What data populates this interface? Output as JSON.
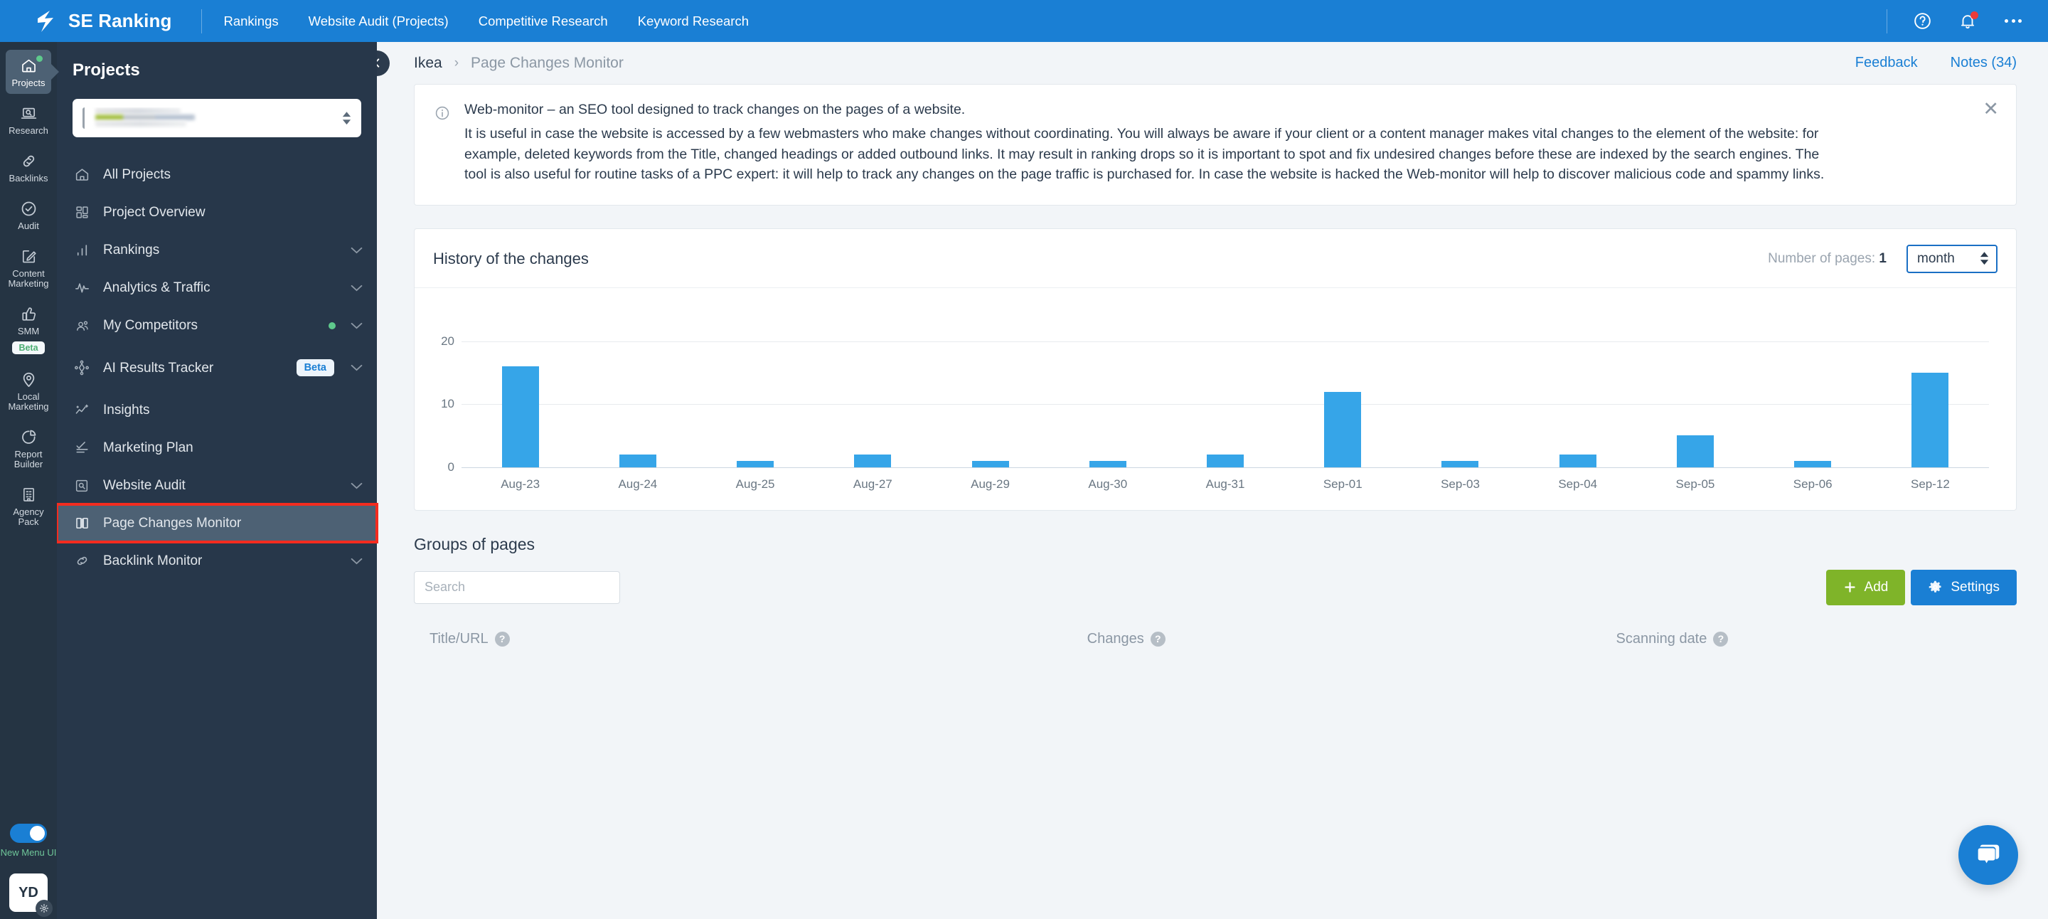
{
  "topbar": {
    "brand": "SE Ranking",
    "nav": [
      {
        "label": "Rankings"
      },
      {
        "label": "Website Audit (Projects)"
      },
      {
        "label": "Competitive Research"
      },
      {
        "label": "Keyword Research"
      }
    ]
  },
  "rail": {
    "items": [
      {
        "label": "Projects",
        "icon": "home-icon",
        "active": true,
        "dot": true
      },
      {
        "label": "Research",
        "icon": "laptop-search-icon",
        "active": false,
        "dot": false
      },
      {
        "label": "Backlinks",
        "icon": "link-icon",
        "active": false,
        "dot": false
      },
      {
        "label": "Audit",
        "icon": "check-circle-icon",
        "active": false,
        "dot": false
      },
      {
        "label": "Content Marketing",
        "icon": "pencil-square-icon",
        "active": false,
        "dot": false
      },
      {
        "label": "SMM",
        "icon": "thumbs-up-icon",
        "active": false,
        "dot": false,
        "badge": "Beta"
      },
      {
        "label": "Local Marketing",
        "icon": "map-pin-icon",
        "active": false,
        "dot": false
      },
      {
        "label": "Report Builder",
        "icon": "pie-chart-icon",
        "active": false,
        "dot": false
      },
      {
        "label": "Agency Pack",
        "icon": "building-icon",
        "active": false,
        "dot": false
      }
    ],
    "toggle_label": "New Menu UI",
    "avatar_initials": "YD"
  },
  "projects_panel": {
    "title": "Projects",
    "selected_project": "",
    "menu": [
      {
        "label": "All Projects",
        "icon": "home-icon",
        "chevron": false
      },
      {
        "label": "Project Overview",
        "icon": "grid-icon",
        "chevron": false
      },
      {
        "label": "Rankings",
        "icon": "bar-chart-icon",
        "chevron": true
      },
      {
        "label": "Analytics & Traffic",
        "icon": "pulse-icon",
        "chevron": true
      },
      {
        "label": "My Competitors",
        "icon": "people-icon",
        "chevron": true,
        "dot": true
      },
      {
        "label": "AI Results Tracker",
        "icon": "ai-node-icon",
        "chevron": true,
        "badge": "Beta"
      },
      {
        "label": "Insights",
        "icon": "insights-icon",
        "chevron": false
      },
      {
        "label": "Marketing Plan",
        "icon": "plan-icon",
        "chevron": false
      },
      {
        "label": "Website Audit",
        "icon": "magnifier-box-icon",
        "chevron": true
      },
      {
        "label": "Page Changes Monitor",
        "icon": "book-open-icon",
        "chevron": false,
        "active": true,
        "highlighted": true
      },
      {
        "label": "Backlink Monitor",
        "icon": "link-icon",
        "chevron": true
      }
    ]
  },
  "breadcrumb": {
    "parent": "Ikea",
    "separator": "›",
    "current": "Page Changes Monitor",
    "feedback": "Feedback",
    "notes": "Notes (34)"
  },
  "notice": {
    "line1": "Web-monitor – an SEO tool designed to track changes on the pages of a website.",
    "paragraph": "It is useful in case the website is accessed by a few webmasters who make changes without coordinating. You will always be aware if your client or a content manager makes vital changes to the element of the website: for example, deleted keywords from the Title, changed headings or added outbound links. It may result in ranking drops so it is important to spot and fix undesired changes before these are indexed by the search engines. The tool is also useful for routine tasks of a PPC expert: it will help to track any changes on the page traffic is purchased for. In case the website is hacked the Web-monitor will help to discover malicious code and spammy links.",
    "close": "✕"
  },
  "chart_panel": {
    "title": "History of the changes",
    "pages_label": "Number of pages:",
    "pages_value": "1",
    "period_value": "month"
  },
  "chart_data": {
    "type": "bar",
    "title": "History of the changes",
    "xlabel": "",
    "ylabel": "",
    "ylim": [
      0,
      24
    ],
    "yticks": [
      0,
      10,
      20
    ],
    "grid": true,
    "legend": "none",
    "bar_color": "#36a5e8",
    "categories": [
      "Aug-23",
      "Aug-24",
      "Aug-25",
      "Aug-27",
      "Aug-29",
      "Aug-30",
      "Aug-31",
      "Sep-01",
      "Sep-03",
      "Sep-04",
      "Sep-05",
      "Sep-06",
      "Sep-12"
    ],
    "values": [
      16,
      2,
      1,
      2,
      1,
      1,
      2,
      12,
      1,
      2,
      5,
      1,
      15
    ]
  },
  "groups": {
    "title": "Groups of pages",
    "search_placeholder": "Search",
    "search_value": "",
    "add_label": "Add",
    "settings_label": "Settings",
    "columns": [
      {
        "label": "Title/URL"
      },
      {
        "label": "Changes"
      },
      {
        "label": "Scanning date"
      }
    ]
  }
}
